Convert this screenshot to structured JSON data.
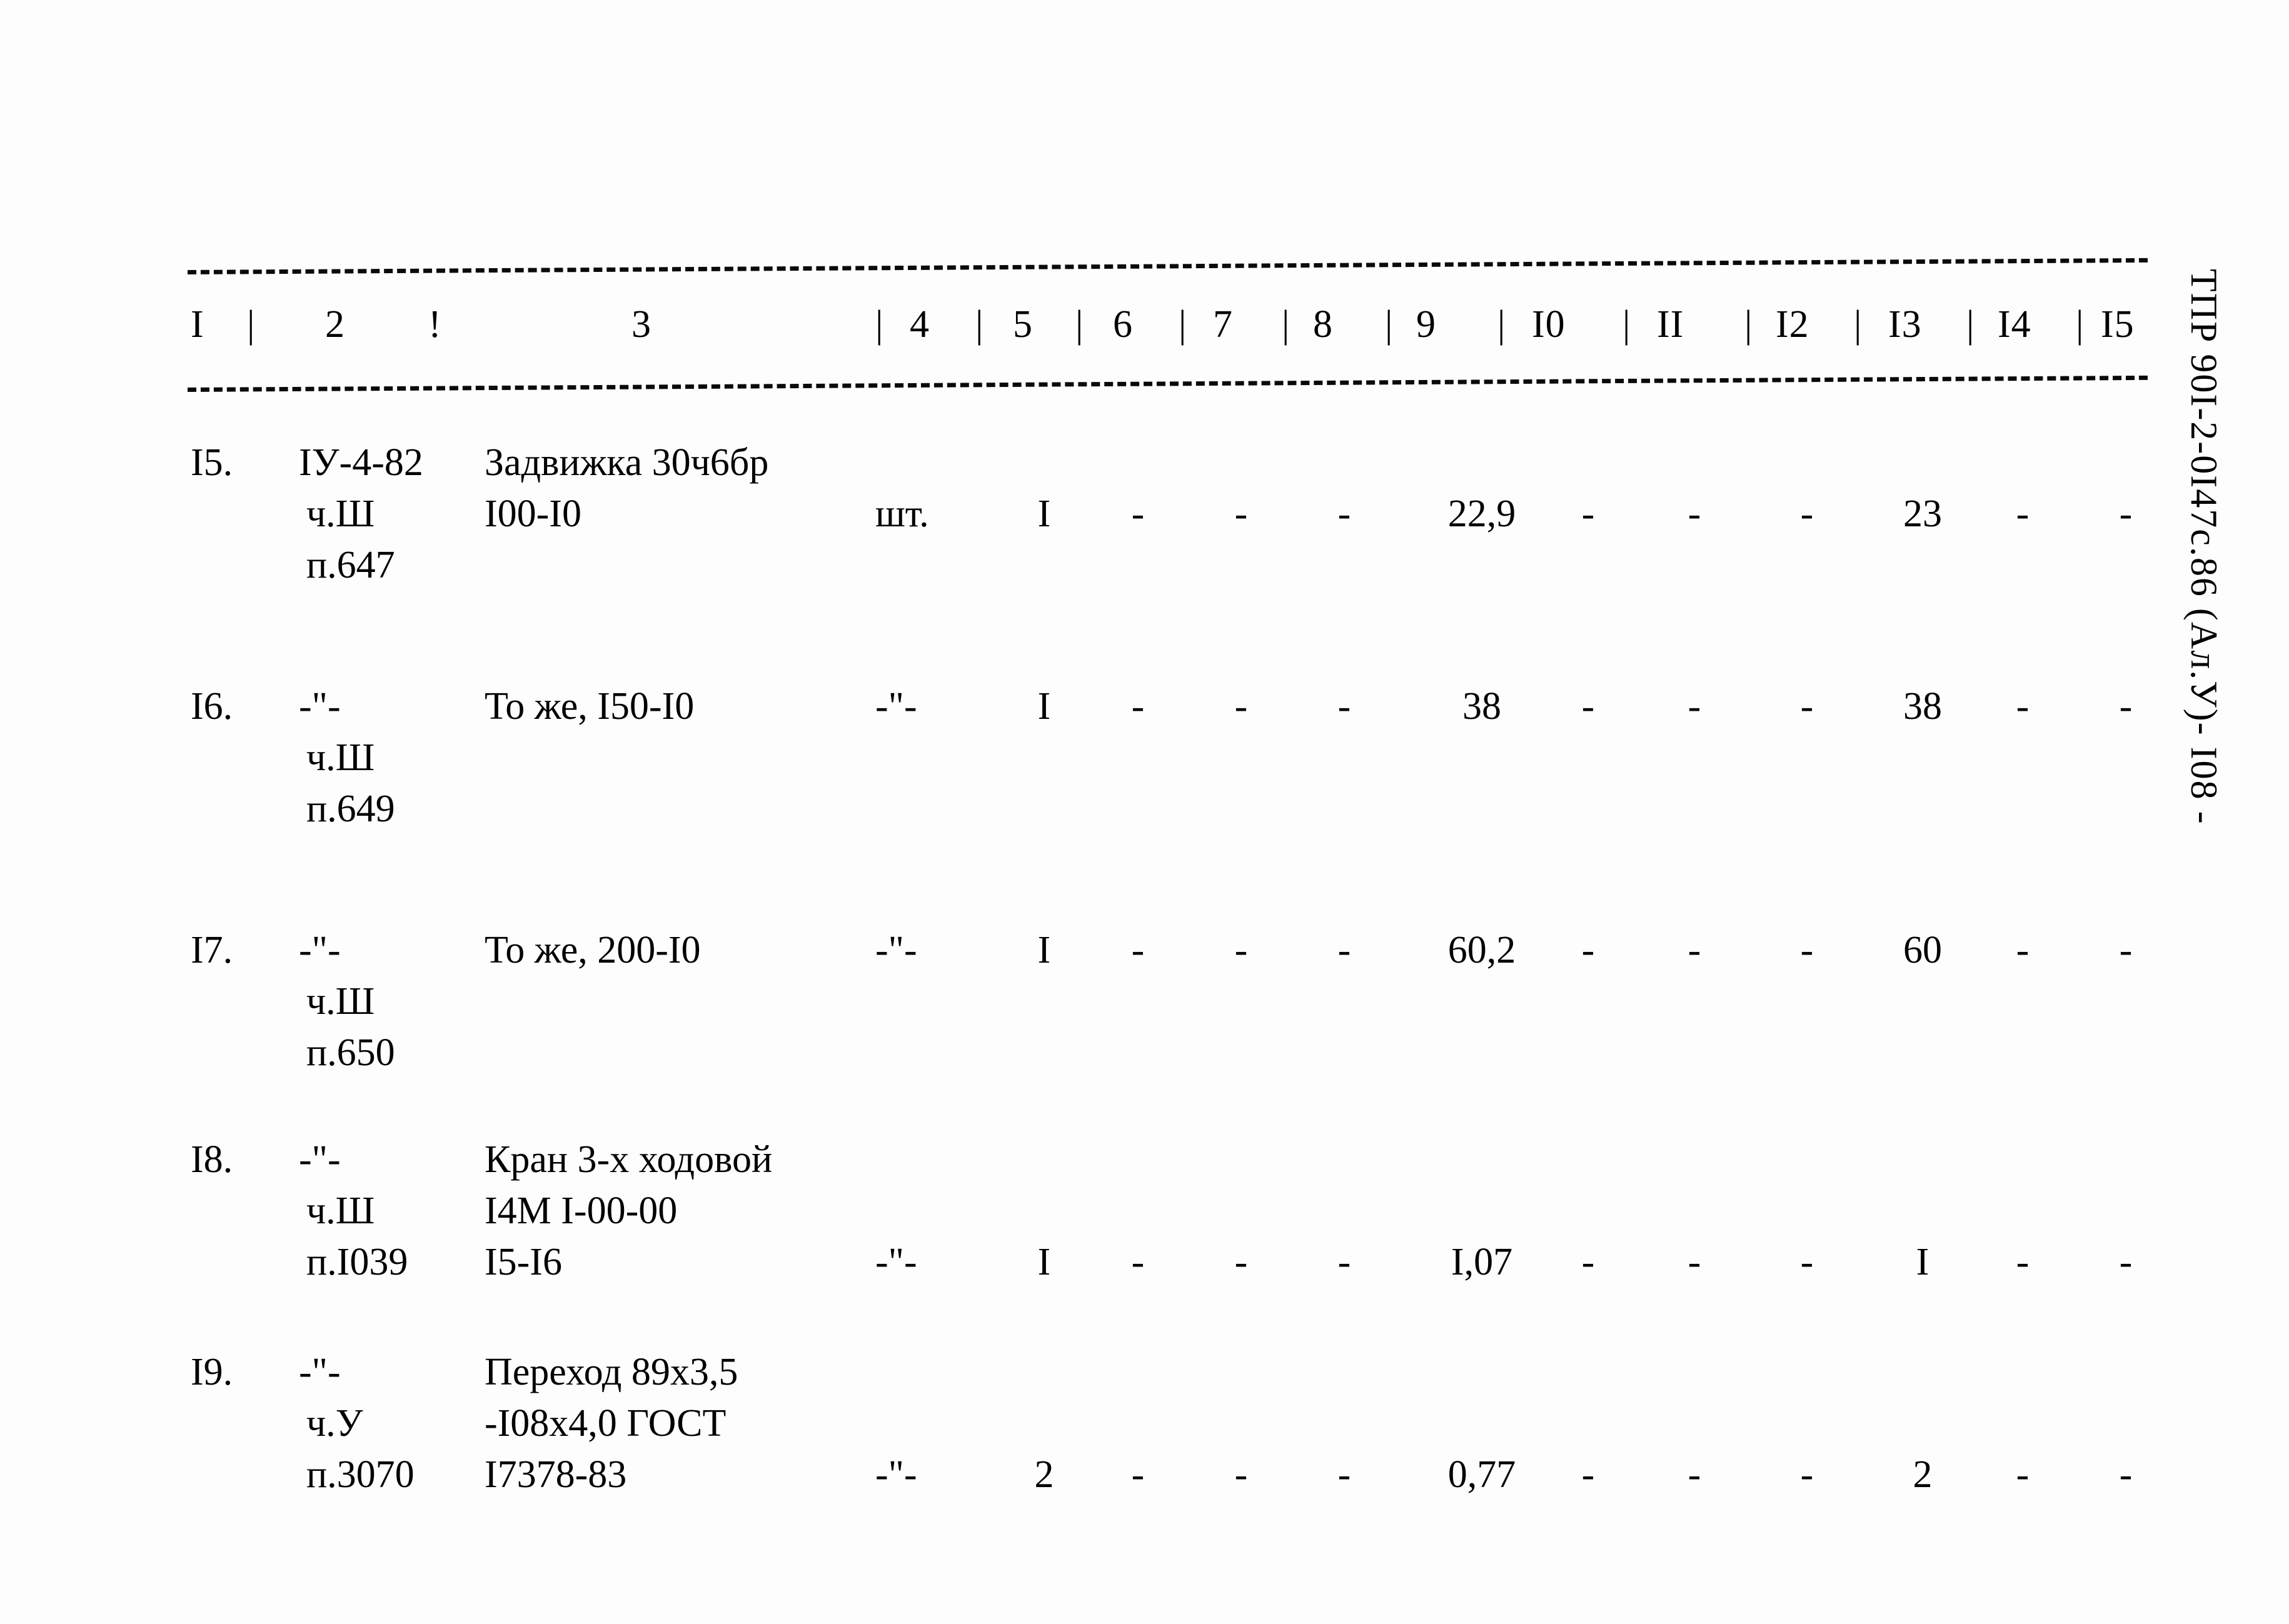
{
  "document": {
    "stamp_vertical": "ТПР 90I-2-0I47с.86 (Ал.У)-   I08 -"
  },
  "table": {
    "header": {
      "cells": [
        "I",
        "|",
        "2",
        "!",
        "3",
        "|",
        "4",
        "|",
        "5",
        "|",
        "6",
        "|",
        "7",
        "|",
        "8",
        "|",
        "9",
        "|",
        "I0",
        "|",
        "II",
        "|",
        "I2",
        "|",
        "I3",
        "|",
        "I4",
        "|",
        "I5"
      ]
    },
    "rows": [
      {
        "num": "I5.",
        "code_lines": [
          "IУ-4-82",
          "ч.Ш",
          "п.647"
        ],
        "name_lines": [
          "Задвижка 30ч6бр",
          "I00-I0",
          ""
        ],
        "unit": "шт.",
        "values": [
          "I",
          "-",
          "-",
          "-",
          "22,9",
          "-",
          "-",
          "-",
          "23",
          "-",
          "-"
        ]
      },
      {
        "num": "I6.",
        "code_lines": [
          "-\"-",
          "ч.Ш",
          "п.649"
        ],
        "name_lines": [
          "То же, I50-I0",
          "",
          ""
        ],
        "unit": "-\"-",
        "values": [
          "I",
          "-",
          "-",
          "-",
          "38",
          "-",
          "-",
          "-",
          "38",
          "-",
          "-"
        ]
      },
      {
        "num": "I7.",
        "code_lines": [
          "-\"-",
          "ч.Ш",
          "п.650"
        ],
        "name_lines": [
          "То же, 200-I0",
          "",
          ""
        ],
        "unit": "-\"-",
        "values": [
          "I",
          "-",
          "-",
          "-",
          "60,2",
          "-",
          "-",
          "-",
          "60",
          "-",
          "-"
        ]
      },
      {
        "num": "I8.",
        "code_lines": [
          "-\"-",
          "ч.Ш",
          "п.I039"
        ],
        "name_lines": [
          "Кран 3-х ходовой",
          "I4М I-00-00",
          "I5-I6"
        ],
        "unit": "-\"-",
        "values": [
          "I",
          "-",
          "-",
          "-",
          "I,07",
          "-",
          "-",
          "-",
          "I",
          "-",
          "-"
        ]
      },
      {
        "num": "I9.",
        "code_lines": [
          "-\"-",
          "ч.У",
          "п.3070"
        ],
        "name_lines": [
          "Переход 89х3,5",
          "-I08х4,0 ГОСТ",
          "I7378-83"
        ],
        "unit": "-\"-",
        "values": [
          "2",
          "-",
          "-",
          "-",
          "0,77",
          "-",
          "-",
          "-",
          "2",
          "-",
          "-"
        ]
      }
    ]
  }
}
